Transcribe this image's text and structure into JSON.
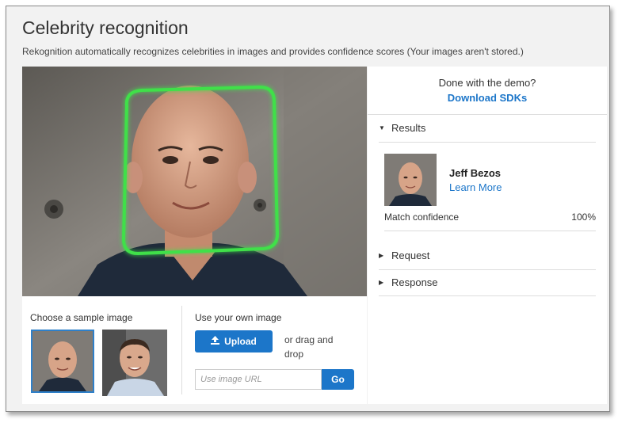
{
  "header": {
    "title": "Celebrity recognition",
    "subtitle": "Rekognition automatically recognizes celebrities in images and provides confidence scores (Your images aren't stored.)"
  },
  "samples": {
    "label": "Choose a sample image",
    "images": [
      "sample-image-1",
      "sample-image-2"
    ]
  },
  "own_image": {
    "label": "Use your own image",
    "upload_label": "Upload",
    "drag_text": "or drag and drop",
    "url_placeholder": "Use image URL",
    "go_label": "Go"
  },
  "sidebar": {
    "done_text": "Done with the demo?",
    "sdk_link": "Download SDKs"
  },
  "results": {
    "section_label": "Results",
    "celebrity_name": "Jeff Bezos",
    "learn_more": "Learn More",
    "match_label": "Match confidence",
    "match_value": "100%"
  },
  "request": {
    "label": "Request"
  },
  "response": {
    "label": "Response"
  },
  "colors": {
    "accent": "#1c76c9",
    "face_box": "#3fe04a"
  }
}
